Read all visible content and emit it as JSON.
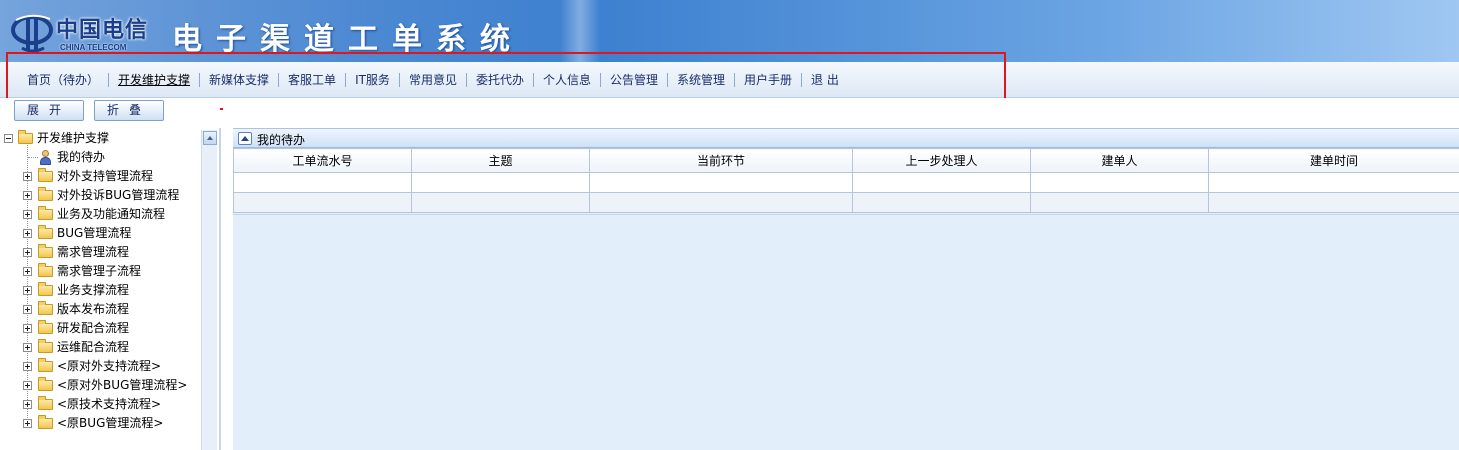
{
  "header": {
    "logo_cn": "中国电信",
    "logo_en": "CHINA TELECOM",
    "system_title": "电子渠道工单系统"
  },
  "nav": {
    "items": [
      {
        "label": "首页（待办）",
        "active": false
      },
      {
        "label": "开发维护支撑",
        "active": true
      },
      {
        "label": "新媒体支撑",
        "active": false
      },
      {
        "label": "客服工单",
        "active": false
      },
      {
        "label": "IT服务",
        "active": false
      },
      {
        "label": "常用意见",
        "active": false
      },
      {
        "label": "委托代办",
        "active": false
      },
      {
        "label": "个人信息",
        "active": false
      },
      {
        "label": "公告管理",
        "active": false
      },
      {
        "label": "系统管理",
        "active": false
      },
      {
        "label": "用户手册",
        "active": false
      },
      {
        "label": "退  出",
        "active": false
      }
    ],
    "highlight_color": "#e0161c"
  },
  "toolbar": {
    "expand_label": "展开",
    "collapse_label": "折叠"
  },
  "tree": {
    "root": "开发维护支撑",
    "items": [
      {
        "label": "我的待办",
        "type": "user"
      },
      {
        "label": "对外支持管理流程",
        "type": "folder"
      },
      {
        "label": "对外投诉BUG管理流程",
        "type": "folder"
      },
      {
        "label": "业务及功能通知流程",
        "type": "folder"
      },
      {
        "label": "BUG管理流程",
        "type": "folder"
      },
      {
        "label": "需求管理流程",
        "type": "folder"
      },
      {
        "label": "需求管理子流程",
        "type": "folder"
      },
      {
        "label": "业务支撑流程",
        "type": "folder"
      },
      {
        "label": "版本发布流程",
        "type": "folder"
      },
      {
        "label": "研发配合流程",
        "type": "folder"
      },
      {
        "label": "运维配合流程",
        "type": "folder"
      },
      {
        "label": "<原对外支持流程>",
        "type": "folder"
      },
      {
        "label": "<原对外BUG管理流程>",
        "type": "folder"
      },
      {
        "label": "<原技术支持流程>",
        "type": "folder"
      },
      {
        "label": "<原BUG管理流程>",
        "type": "folder"
      }
    ]
  },
  "panel": {
    "title": "我的待办",
    "columns": [
      "工单流水号",
      "主题",
      "当前环节",
      "上一步处理人",
      "建单人",
      "建单时间"
    ],
    "rows": [
      [
        "",
        "",
        "",
        "",
        "",
        ""
      ],
      [
        "",
        "",
        "",
        "",
        "",
        ""
      ]
    ]
  },
  "colors": {
    "header_blue": "#3c7fcf",
    "nav_text": "#1a2e6b",
    "panel_bg": "#e2eef9"
  }
}
